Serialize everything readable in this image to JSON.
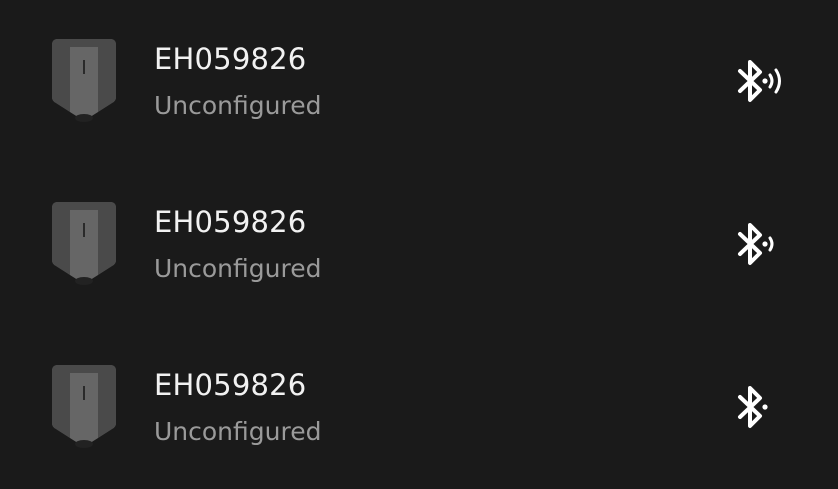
{
  "devices": [
    {
      "name": "EH059826",
      "status": "Unconfigured",
      "signal_icon": "bluetooth-signal-strong-icon"
    },
    {
      "name": "EH059826",
      "status": "Unconfigured",
      "signal_icon": "bluetooth-signal-medium-icon"
    },
    {
      "name": "EH059826",
      "status": "Unconfigured",
      "signal_icon": "bluetooth-signal-weak-icon"
    }
  ],
  "colors": {
    "background": "#1a1a1a",
    "name_text": "#f2f2f2",
    "status_text": "#9a9a9a",
    "icon": "#ffffff"
  }
}
